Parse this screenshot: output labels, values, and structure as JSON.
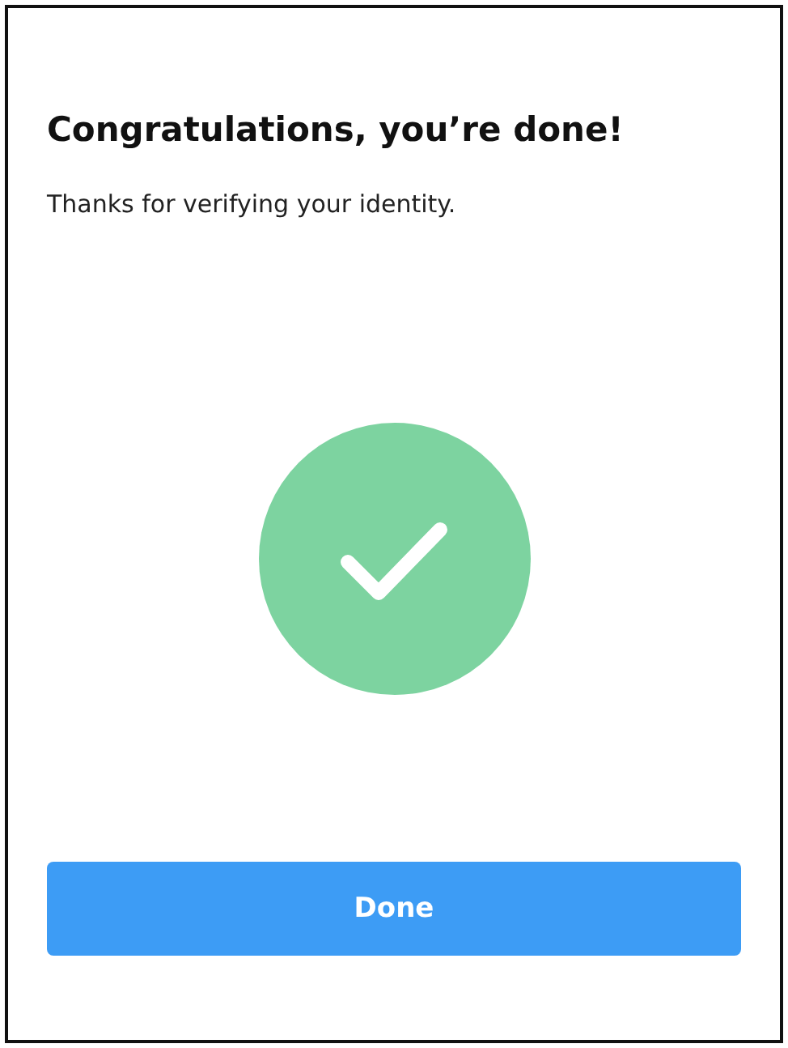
{
  "title": "Congratulations, you’re done!",
  "message": "Thanks for verifying your identity.",
  "status": {
    "kind": "success"
  },
  "button": {
    "label": "Done"
  }
}
